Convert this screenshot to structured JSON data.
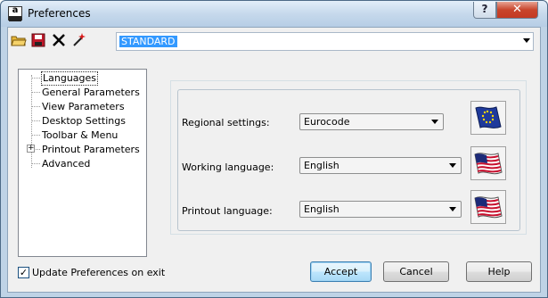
{
  "window": {
    "title": "Preferences",
    "help_glyph": "?",
    "close_glyph": "✕"
  },
  "toolbar": {
    "profile_value": "STANDARD",
    "icons": [
      "open-folder-icon",
      "save-icon",
      "delete-icon",
      "new-icon"
    ]
  },
  "tree": {
    "items": [
      {
        "label": "Languages",
        "selected": true
      },
      {
        "label": "General Parameters"
      },
      {
        "label": "View Parameters"
      },
      {
        "label": "Desktop Settings"
      },
      {
        "label": "Toolbar & Menu"
      },
      {
        "label": "Printout Parameters",
        "expandable": true
      },
      {
        "label": "Advanced"
      }
    ],
    "expander_glyph": "+"
  },
  "languages": {
    "regional_label": "Regional settings:",
    "regional_value": "Eurocode",
    "working_label": "Working language:",
    "working_value": "English",
    "printout_label": "Printout language:",
    "printout_value": "English"
  },
  "footer": {
    "update_checkbox_label": "Update Preferences on exit",
    "update_checked": true,
    "check_glyph": "✓",
    "accept_label": "Accept",
    "cancel_label": "Cancel",
    "help_label": "Help"
  },
  "colors": {
    "selection": "#3399ff",
    "eu_blue": "#1f3a9b",
    "eu_star": "#ffd700",
    "us_red": "#c8102e",
    "us_blue": "#1c2a78"
  }
}
